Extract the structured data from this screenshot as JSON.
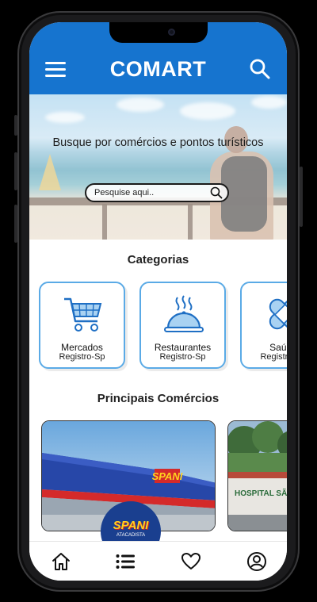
{
  "app": {
    "title": "COMART"
  },
  "hero": {
    "headline": "Busque por comércios e pontos turísticos",
    "search_placeholder": "Pesquise aqui.."
  },
  "categories": {
    "title": "Categorias",
    "items": [
      {
        "name": "Mercados",
        "sub": "Registro-Sp",
        "icon": "shopping-cart-icon"
      },
      {
        "name": "Restaurantes",
        "sub": "Registro-Sp",
        "icon": "food-cloche-icon"
      },
      {
        "name": "Saúde",
        "sub": "Registro-Sp",
        "icon": "bandage-icon"
      }
    ]
  },
  "businesses": {
    "title": "Principais Comércios",
    "items": [
      {
        "name": "SPANI",
        "sub": "ATACADISTA",
        "sign": "SPANI"
      },
      {
        "sign": "HOSPITAL SÃO"
      }
    ]
  },
  "nav": {
    "items": [
      {
        "icon": "home-icon"
      },
      {
        "icon": "list-icon"
      },
      {
        "icon": "heart-icon"
      },
      {
        "icon": "profile-icon"
      }
    ]
  },
  "colors": {
    "primary": "#1674cf",
    "card_border": "#5aaae6"
  }
}
